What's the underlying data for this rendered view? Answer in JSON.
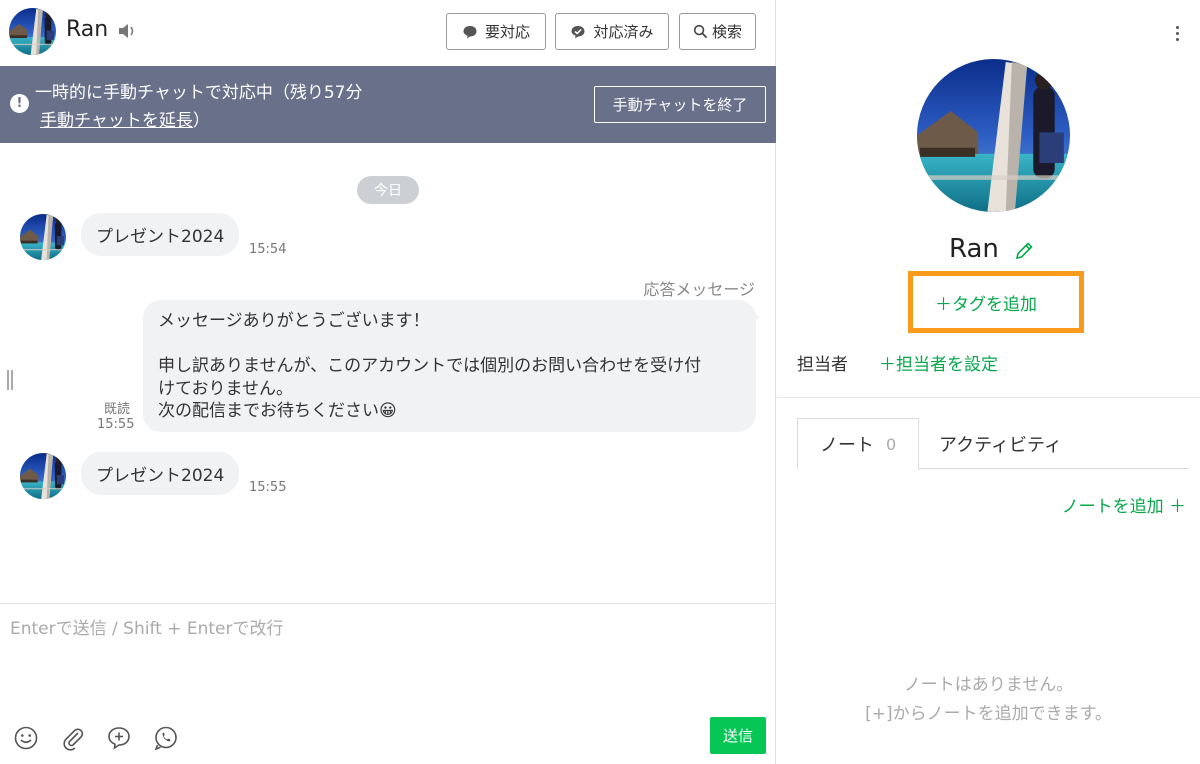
{
  "colors": {
    "accent_green": "#06c755",
    "link_green": "#06a84a",
    "banner_bg": "#68708a",
    "highlight_orange": "#f89a1c",
    "bubble_bg": "#f0f2f4"
  },
  "header": {
    "user_name": "Ran",
    "buttons": [
      {
        "label": "要対応",
        "icon": "chat-bubble-icon"
      },
      {
        "label": "対応済み",
        "icon": "check-bubble-icon"
      },
      {
        "label": "検索",
        "icon": "search-icon"
      }
    ]
  },
  "banner": {
    "line1": "一時的に手動チャットで対応中（残り57分",
    "link": "手動チャットを延長",
    "close_paren": "）",
    "end_button": "手動チャットを終了"
  },
  "chat": {
    "date_label": "今日",
    "messages": [
      {
        "text": "プレゼント2024",
        "time": "15:54"
      },
      {
        "label": "応答メッセージ",
        "line1": "メッセージありがとうございます！",
        "line2": "",
        "line3": "申し訳ありませんが、このアカウントでは個別のお問い合わせを受け付",
        "line4": "けておりません。",
        "line5": "次の配信までお待ちください😀",
        "read": "既読",
        "time": "15:55"
      },
      {
        "text": "プレゼント2024",
        "time": "15:55"
      }
    ]
  },
  "composer": {
    "placeholder": "Enterで送信 / Shift + Enterで改行",
    "send_label": "送信",
    "tools": [
      "emoji-icon",
      "attachment-icon",
      "add-message-icon",
      "call-icon"
    ]
  },
  "profile": {
    "name": "Ran",
    "tag_add": "＋タグを追加",
    "assignee_label": "担当者",
    "assignee_add": "＋担当者を設定",
    "tabs": [
      {
        "label": "ノート",
        "count": "0"
      },
      {
        "label": "アクティビティ"
      }
    ],
    "note_add": "ノートを追加 ＋",
    "empty_line1": "ノートはありません。",
    "empty_line2": "[+]からノートを追加できます。"
  }
}
